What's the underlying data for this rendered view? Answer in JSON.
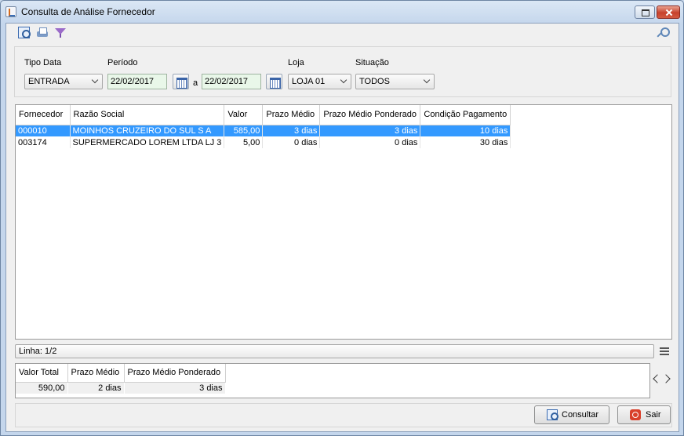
{
  "window": {
    "title": "Consulta de Análise Fornecedor"
  },
  "toolbar": {
    "icons": [
      "search-icon",
      "print-icon",
      "filter-icon",
      "key-icon"
    ]
  },
  "filters": {
    "tipo_data": {
      "label": "Tipo Data",
      "value": "ENTRADA"
    },
    "periodo": {
      "label": "Período",
      "from": "22/02/2017",
      "separator": "a",
      "to": "22/02/2017"
    },
    "loja": {
      "label": "Loja",
      "value": "LOJA 01"
    },
    "situacao": {
      "label": "Situação",
      "value": "TODOS"
    }
  },
  "grid": {
    "columns": [
      "Fornecedor",
      "Razão Social",
      "Valor",
      "Prazo Médio",
      "Prazo Médio Ponderado",
      "Condição Pagamento"
    ],
    "rows": [
      {
        "fornecedor": "000010",
        "razao_social": "MOINHOS CRUZEIRO DO SUL S A",
        "valor": "585,00",
        "prazo_medio": "3 dias",
        "prazo_ponderado": "3 dias",
        "condicao": "10 dias"
      },
      {
        "fornecedor": "003174",
        "razao_social": "SUPERMERCADO LOREM LTDA LJ 3",
        "valor": "5,00",
        "prazo_medio": "0 dias",
        "prazo_ponderado": "0 dias",
        "condicao": "30 dias"
      }
    ],
    "selected_row": 0
  },
  "status": {
    "linha": "Linha: 1/2"
  },
  "totals": {
    "columns": [
      "Valor Total",
      "Prazo Médio",
      "Prazo Médio Ponderado"
    ],
    "values": [
      "590,00",
      "2 dias",
      "3 dias"
    ]
  },
  "buttons": {
    "consultar": "Consultar",
    "sair": "Sair"
  },
  "colors": {
    "selection": "#3399ff",
    "date_field": "#e9f7e9"
  }
}
